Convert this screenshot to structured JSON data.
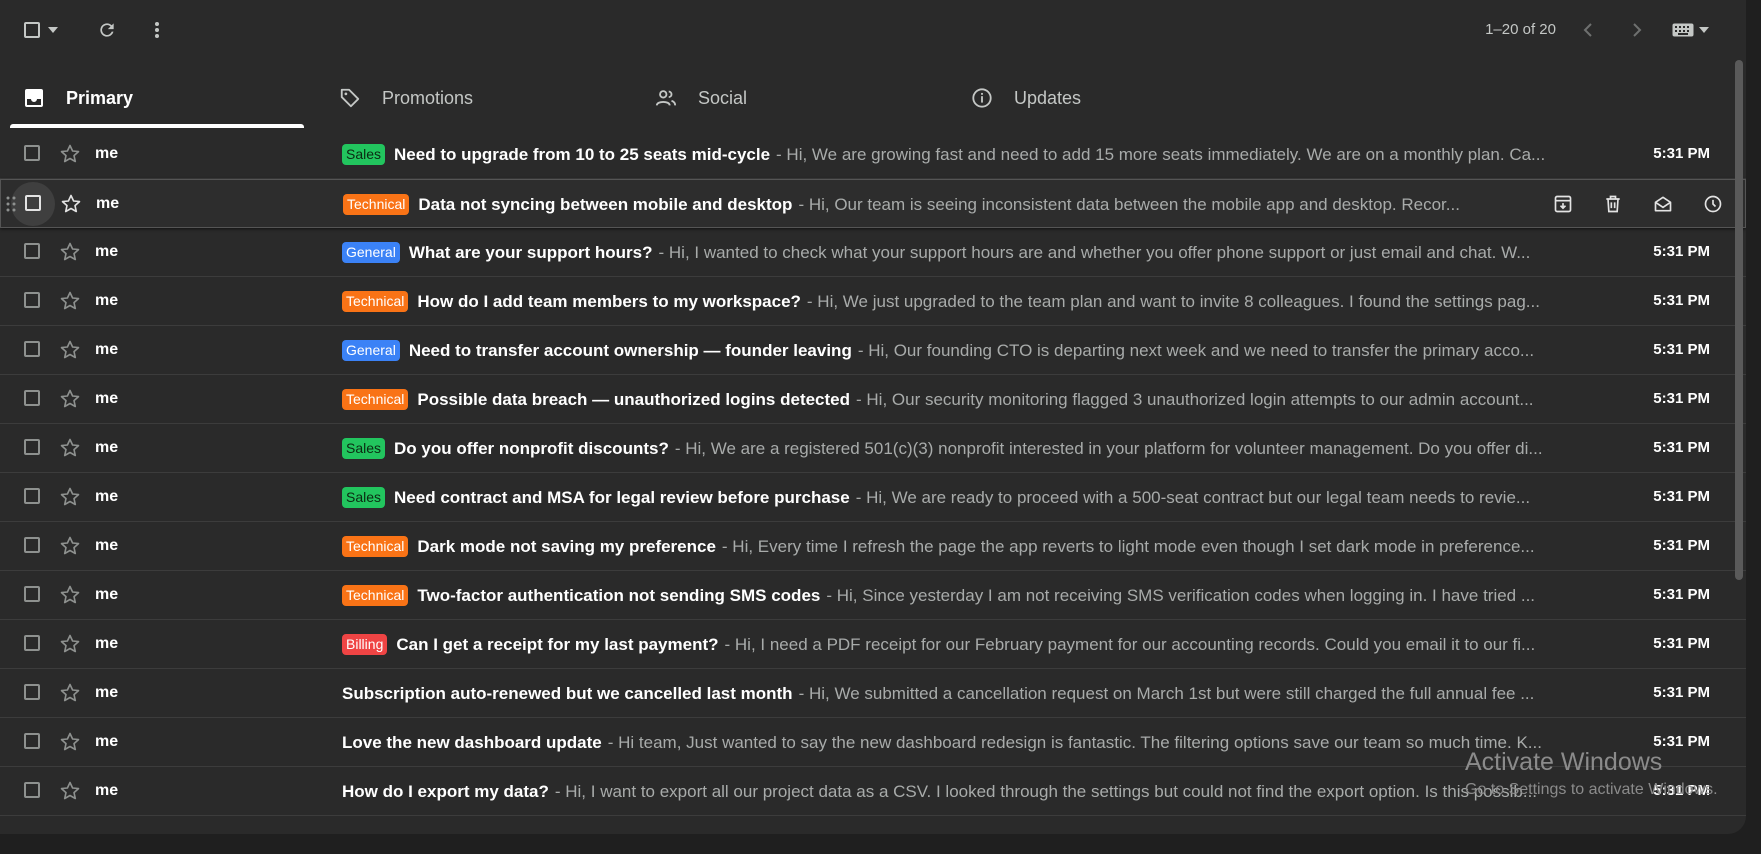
{
  "pager": {
    "range": "1–20 of 20"
  },
  "tabs": [
    {
      "label": "Primary",
      "icon": "inbox-icon"
    },
    {
      "label": "Promotions",
      "icon": "tag-icon"
    },
    {
      "label": "Social",
      "icon": "people-icon"
    },
    {
      "label": "Updates",
      "icon": "info-icon"
    }
  ],
  "colors": {
    "sales": "#22c55e",
    "technical": "#f97316",
    "general": "#3b82f6",
    "billing": "#ef4444"
  },
  "emails": [
    {
      "sender": "me",
      "tag": "Sales",
      "subject": "Need to upgrade from 10 to 25 seats mid-cycle",
      "snippet": "- Hi, We are growing fast and need to add 15 more seats immediately. We are on a monthly plan. Ca...",
      "time": "5:31 PM"
    },
    {
      "sender": "me",
      "tag": "Technical",
      "subject": "Data not syncing between mobile and desktop",
      "snippet": "- Hi, Our team is seeing inconsistent data between the mobile app and desktop. Recor...",
      "time": "5:31 PM"
    },
    {
      "sender": "me",
      "tag": "General",
      "subject": "What are your support hours?",
      "snippet": "- Hi, I wanted to check what your support hours are and whether you offer phone support or just email and chat. W...",
      "time": "5:31 PM"
    },
    {
      "sender": "me",
      "tag": "Technical",
      "subject": "How do I add team members to my workspace?",
      "snippet": "- Hi, We just upgraded to the team plan and want to invite 8 colleagues. I found the settings pag...",
      "time": "5:31 PM"
    },
    {
      "sender": "me",
      "tag": "General",
      "subject": "Need to transfer account ownership — founder leaving",
      "snippet": "- Hi, Our founding CTO is departing next week and we need to transfer the primary acco...",
      "time": "5:31 PM"
    },
    {
      "sender": "me",
      "tag": "Technical",
      "subject": "Possible data breach — unauthorized logins detected",
      "snippet": "- Hi, Our security monitoring flagged 3 unauthorized login attempts to our admin account...",
      "time": "5:31 PM"
    },
    {
      "sender": "me",
      "tag": "Sales",
      "subject": "Do you offer nonprofit discounts?",
      "snippet": "- Hi, We are a registered 501(c)(3) nonprofit interested in your platform for volunteer management. Do you offer di...",
      "time": "5:31 PM"
    },
    {
      "sender": "me",
      "tag": "Sales",
      "subject": "Need contract and MSA for legal review before purchase",
      "snippet": "- Hi, We are ready to proceed with a 500-seat contract but our legal team needs to revie...",
      "time": "5:31 PM"
    },
    {
      "sender": "me",
      "tag": "Technical",
      "subject": "Dark mode not saving my preference",
      "snippet": "- Hi, Every time I refresh the page the app reverts to light mode even though I set dark mode in preference...",
      "time": "5:31 PM"
    },
    {
      "sender": "me",
      "tag": "Technical",
      "subject": "Two-factor authentication not sending SMS codes",
      "snippet": "- Hi, Since yesterday I am not receiving SMS verification codes when logging in. I have tried ...",
      "time": "5:31 PM"
    },
    {
      "sender": "me",
      "tag": "Billing",
      "subject": "Can I get a receipt for my last payment?",
      "snippet": "- Hi, I need a PDF receipt for our February payment for our accounting records. Could you email it to our fi...",
      "time": "5:31 PM"
    },
    {
      "sender": "me",
      "tag": "",
      "subject": "Subscription auto-renewed but we cancelled last month",
      "snippet": "- Hi, We submitted a cancellation request on March 1st but were still charged the full annual fee ...",
      "time": "5:31 PM"
    },
    {
      "sender": "me",
      "tag": "",
      "subject": "Love the new dashboard update",
      "snippet": "- Hi team, Just wanted to say the new dashboard redesign is fantastic. The filtering options save our team so much time. K...",
      "time": "5:31 PM"
    },
    {
      "sender": "me",
      "tag": "",
      "subject": "How do I export my data?",
      "snippet": "- Hi, I want to export all our project data as a CSV. I looked through the settings but could not find the export option. Is this possib...",
      "time": "5:31 PM"
    }
  ],
  "watermark": {
    "line1": "Activate Windows",
    "line2": "Go to Settings to activate Windows."
  }
}
